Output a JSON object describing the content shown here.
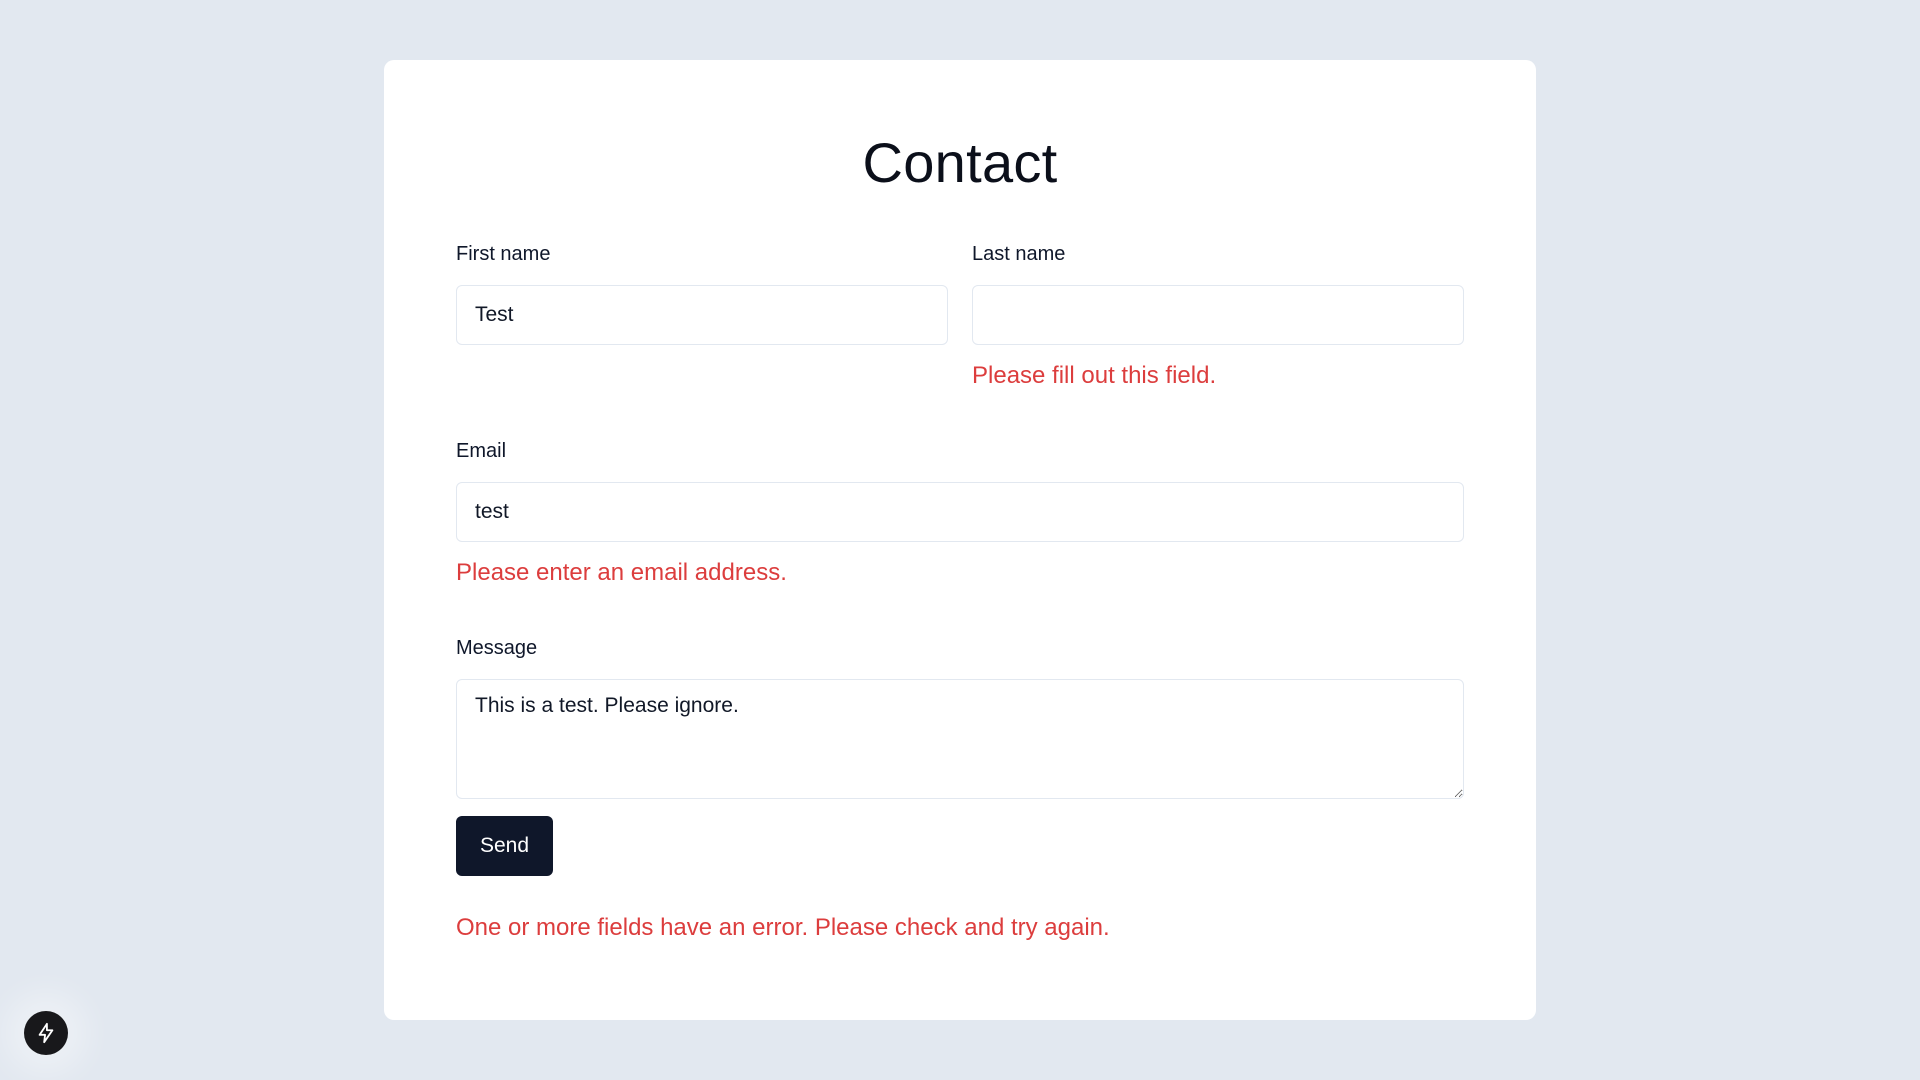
{
  "page": {
    "title": "Contact"
  },
  "form": {
    "first_name": {
      "label": "First name",
      "value": "Test"
    },
    "last_name": {
      "label": "Last name",
      "value": "",
      "error": "Please fill out this field."
    },
    "email": {
      "label": "Email",
      "value": "test",
      "error": "Please enter an email address."
    },
    "message": {
      "label": "Message",
      "value": "This is a test. Please ignore."
    },
    "send_label": "Send",
    "form_error": "One or more fields have an error. Please check and try again."
  },
  "floating_button": {
    "icon": "lightning-icon"
  },
  "colors": {
    "background": "#e2e8f0",
    "error": "#dc3d3d",
    "button": "#0f172a"
  }
}
